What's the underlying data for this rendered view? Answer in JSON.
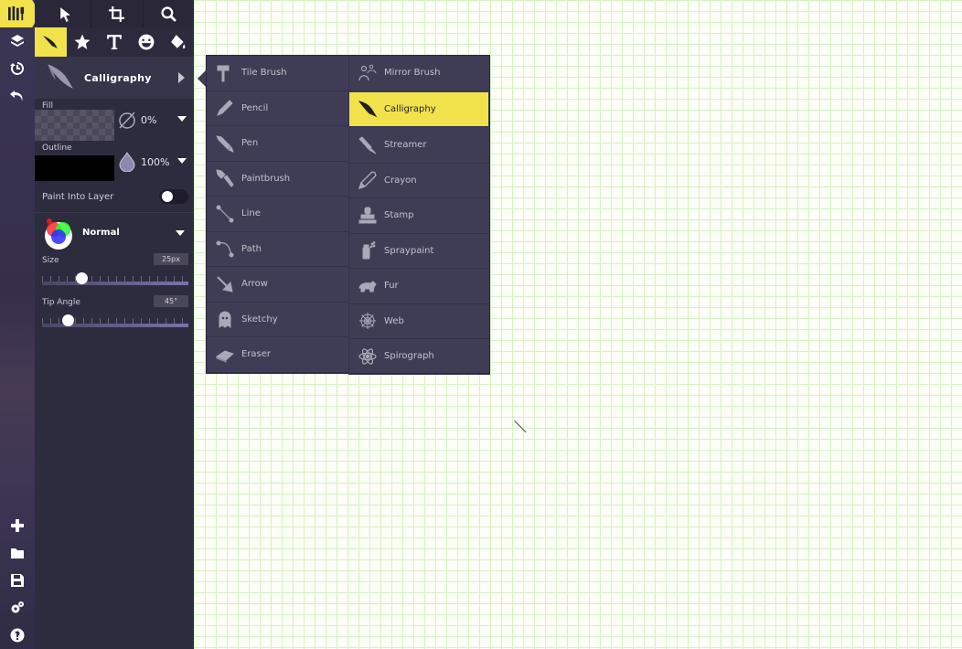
{
  "app": {
    "accent_color": "#f1e24b",
    "panel_color": "#2d2b3e"
  },
  "top_tabs": [
    {
      "name": "tools-logo-icon"
    },
    {
      "name": "select-pointer-icon"
    },
    {
      "name": "crop-icon"
    },
    {
      "name": "zoom-search-icon"
    }
  ],
  "tool_row": [
    {
      "name": "calligraphy-tool-icon",
      "active": true
    },
    {
      "name": "star-shape-icon"
    },
    {
      "name": "text-tool-icon"
    },
    {
      "name": "sticker-face-icon"
    },
    {
      "name": "paint-bucket-icon"
    }
  ],
  "left_rail": {
    "top": [
      "layers-icon",
      "history-icon",
      "undo-icon"
    ],
    "bottom": [
      "add-icon",
      "folder-icon",
      "save-icon",
      "settings-icon",
      "help-icon"
    ]
  },
  "brush_panel": {
    "brush_name": "Calligraphy",
    "fill_label": "Fill",
    "fill_opacity": "0%",
    "outline_label": "Outline",
    "outline_opacity": "100%",
    "paint_into_layer_label": "Paint Into Layer",
    "paint_into_layer_on": false,
    "blend_mode": "Normal",
    "size_label": "Size",
    "size_value": "25px",
    "size_fraction": 0.25,
    "tip_angle_label": "Tip Angle",
    "tip_angle_value": "45°",
    "tip_angle_fraction": 0.15
  },
  "brush_menu": {
    "left": [
      {
        "label": "Tile Brush",
        "icon": "paint-roller-icon"
      },
      {
        "label": "Pencil",
        "icon": "pencil-icon"
      },
      {
        "label": "Pen",
        "icon": "pen-icon"
      },
      {
        "label": "Paintbrush",
        "icon": "paintbrush-icon"
      },
      {
        "label": "Line",
        "icon": "line-icon"
      },
      {
        "label": "Path",
        "icon": "path-icon"
      },
      {
        "label": "Arrow",
        "icon": "arrow-icon"
      },
      {
        "label": "Sketchy",
        "icon": "ghost-icon"
      },
      {
        "label": "Eraser",
        "icon": "eraser-icon"
      }
    ],
    "right": [
      {
        "label": "Mirror Brush",
        "icon": "mirror-person-icon"
      },
      {
        "label": "Calligraphy",
        "icon": "calligraphy-nib-icon",
        "selected": true
      },
      {
        "label": "Streamer",
        "icon": "streamer-icon"
      },
      {
        "label": "Crayon",
        "icon": "crayon-icon"
      },
      {
        "label": "Stamp",
        "icon": "stamp-icon"
      },
      {
        "label": "Spraypaint",
        "icon": "spray-can-icon"
      },
      {
        "label": "Fur",
        "icon": "bear-icon"
      },
      {
        "label": "Web",
        "icon": "spider-web-icon"
      },
      {
        "label": "Spirograph",
        "icon": "atom-spirograph-icon"
      }
    ]
  }
}
